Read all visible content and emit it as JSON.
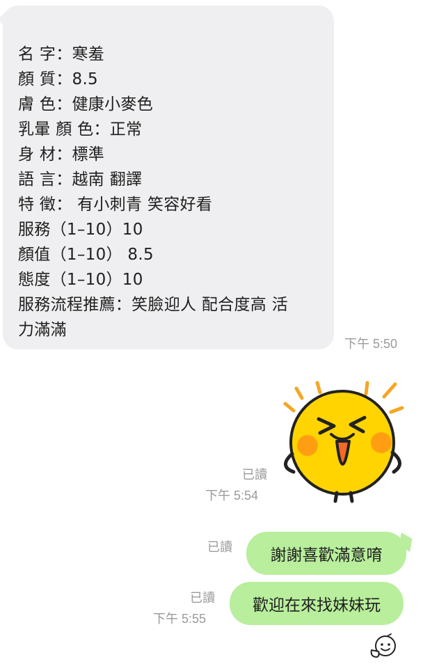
{
  "incoming_message": {
    "lines": [
      "名 字：寒羞",
      "顏 質：8.5",
      "膚 色：健康小麥色",
      "乳暈 顏 色：正常",
      "身 材：標準",
      "語 言：越南 翻譯",
      "特 徵： 有小刺青 笑容好看",
      "服務（1–10）10",
      "顏值（1–10） 8.5",
      "態度（1–10）10",
      "服務流程推薦：笑臉迎人 配合度高 活",
      "力滿滿"
    ],
    "time": "下午 5:50"
  },
  "sticker_message": {
    "read": "已讀",
    "time": "下午 5:54",
    "sticker_icon": "laughing-face-sticker-icon"
  },
  "outgoing_1": {
    "read": "已讀",
    "text": "謝謝喜歡滿意唷"
  },
  "outgoing_2": {
    "read": "已讀",
    "time": "下午 5:55",
    "text": "歡迎在來找妹妹玩"
  },
  "emoji_button": {
    "icon": "emoji-icon"
  },
  "colors": {
    "incoming_bg": "#efeff1",
    "outgoing_bg": "#b8ee9c",
    "meta_text": "#9a9a9a"
  }
}
